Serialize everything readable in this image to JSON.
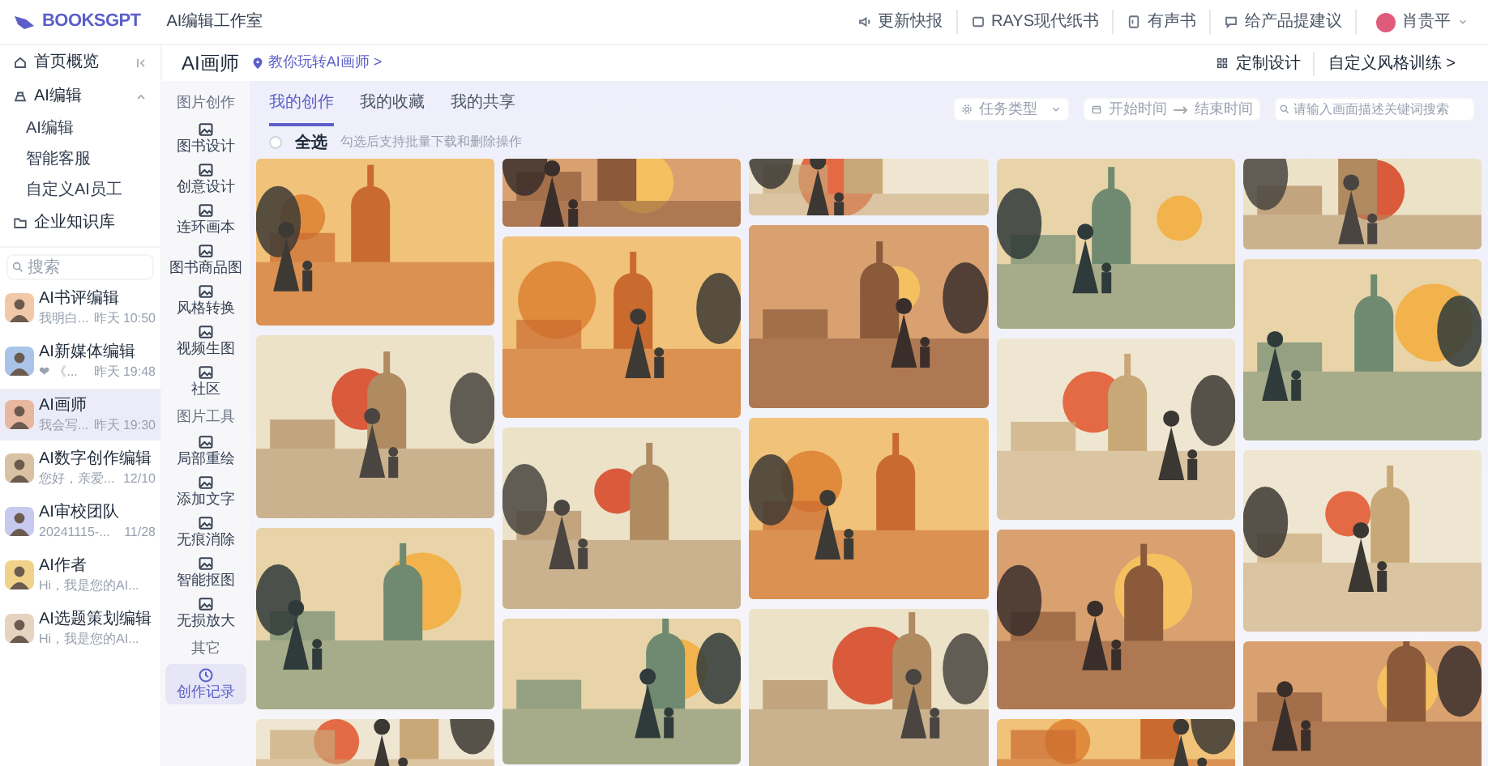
{
  "top_bar": {
    "logo": "BOOKSGPT",
    "app_title": "AI编辑工作室",
    "links": [
      "更新快报",
      "RAYS现代纸书",
      "有声书",
      "给产品提建议"
    ],
    "user": {
      "name": "肖贵平"
    }
  },
  "sidebar": {
    "nav": [
      {
        "kind": "item",
        "label": "首页概览"
      },
      {
        "kind": "group",
        "label": "AI编辑",
        "expanded": true,
        "children": [
          {
            "label": "AI编辑",
            "selected": false
          },
          {
            "label": "智能客服",
            "selected": false
          },
          {
            "label": "自定义AI员工",
            "selected": false
          }
        ]
      },
      {
        "kind": "item",
        "label": "企业知识库"
      }
    ],
    "search": {
      "placeholder": "搜索"
    },
    "chats": [
      {
        "name": "AI书评编辑",
        "preview": "我明白...",
        "time": "昨天 10:50",
        "selected": false
      },
      {
        "name": "AI新媒体编辑",
        "preview": "❤ 《...",
        "time": "昨天 19:48",
        "selected": false
      },
      {
        "name": "AI画师",
        "preview": "我会写...",
        "time": "昨天 19:30",
        "selected": true
      },
      {
        "name": "AI数字创作编辑",
        "preview": "您好，亲爱...",
        "time": "12/10",
        "selected": false
      },
      {
        "name": "AI审校团队",
        "preview": "20241115-...",
        "time": "11/28",
        "selected": false
      },
      {
        "name": "AI作者",
        "preview": "Hi，我是您的AI...",
        "selected": false
      },
      {
        "name": "AI选题策划编辑",
        "preview": "Hi，我是您的AI...",
        "selected": false
      }
    ]
  },
  "header": {
    "title": "AI画师",
    "guide_link": "教你玩转AI画师 >",
    "actions": [
      "定制设计",
      "自定义风格训练 >"
    ]
  },
  "tools": [
    {
      "title": "图片创作",
      "items": [
        {
          "label": "图书设计",
          "selected": false
        },
        {
          "label": "创意设计",
          "selected": false
        },
        {
          "label": "连环画本",
          "selected": false
        },
        {
          "label": "图书商品图",
          "selected": false
        },
        {
          "label": "风格转换",
          "selected": false
        },
        {
          "label": "视频生图",
          "selected": false
        },
        {
          "label": "社区",
          "selected": false
        }
      ]
    },
    {
      "title": "图片工具",
      "items": [
        {
          "label": "局部重绘",
          "selected": false
        },
        {
          "label": "添加文字",
          "selected": false
        },
        {
          "label": "无痕消除",
          "selected": false
        },
        {
          "label": "智能抠图",
          "selected": false
        },
        {
          "label": "无损放大",
          "selected": false
        }
      ]
    },
    {
      "title": "其它",
      "items": [
        {
          "label": "创作记录",
          "selected": true
        }
      ]
    }
  ],
  "tabs": [
    {
      "label": "我的创作",
      "selected": true
    },
    {
      "label": "我的收藏",
      "selected": false
    },
    {
      "label": "我的共享",
      "selected": false
    }
  ],
  "select_all": {
    "label": "全选",
    "checked": false,
    "hint": "勾选后支持批量下载和删除操作"
  },
  "filters": {
    "task_type": {
      "placeholder": "任务类型"
    },
    "start_time": {
      "placeholder": "开始时间"
    },
    "end_time": {
      "placeholder": "结束时间"
    },
    "search": {
      "placeholder": "请输入画面描述关键词搜索"
    }
  }
}
